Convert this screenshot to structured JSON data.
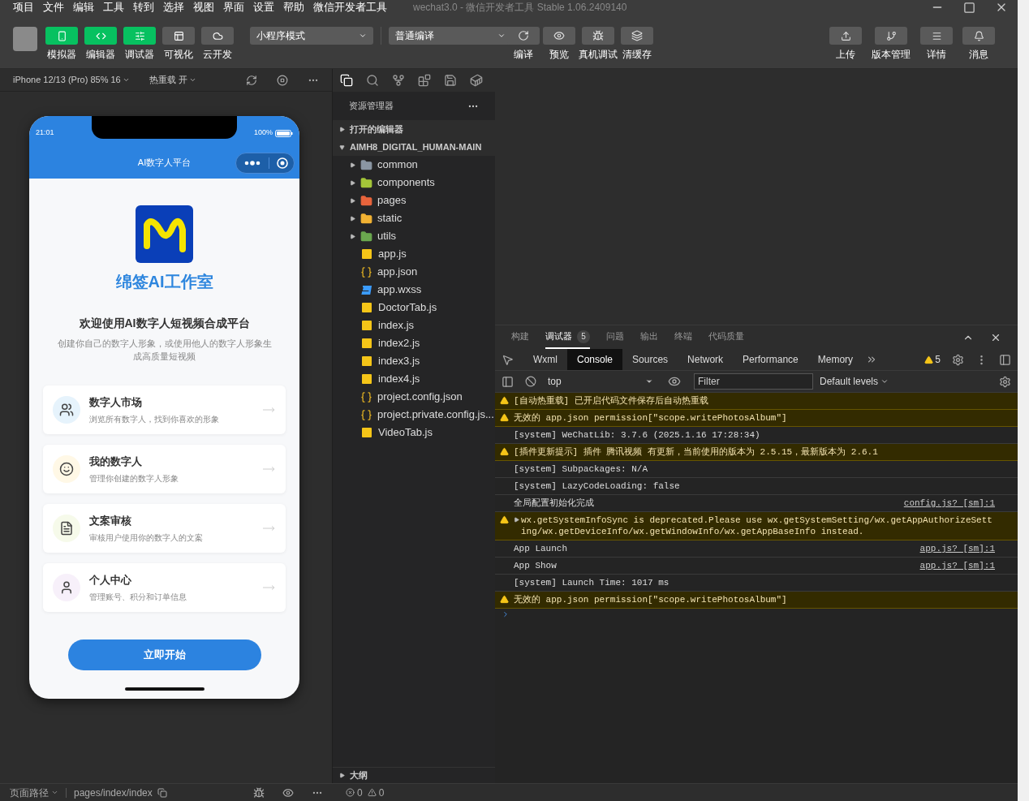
{
  "menu": [
    "项目",
    "文件",
    "编辑",
    "工具",
    "转到",
    "选择",
    "视图",
    "界面",
    "设置",
    "帮助",
    "微信开发者工具"
  ],
  "window_title": "wechat3.0 - 微信开发者工具 Stable 1.06.2409140",
  "toolbar": {
    "mode_buttons": [
      {
        "label": "模拟器",
        "selected": true
      },
      {
        "label": "编辑器",
        "selected": true
      },
      {
        "label": "调试器",
        "selected": true
      },
      {
        "label": "可视化",
        "selected": false
      },
      {
        "label": "云开发",
        "selected": false
      }
    ],
    "mode_select": "小程序模式",
    "compile_select": "普通编译",
    "actions": [
      "编译",
      "预览",
      "真机调试",
      "清缓存"
    ],
    "right_actions": [
      "上传",
      "版本管理",
      "详情",
      "消息"
    ]
  },
  "simulator": {
    "device": "iPhone 12/13 (Pro) 85% 16",
    "hot_reload": "热重载 开",
    "phone": {
      "time": "21:01",
      "battery": "100%",
      "nav_title": "AI数字人平台",
      "brand": "绵签AI工作室",
      "heading": "欢迎使用AI数字人短视频合成平台",
      "subtitle": "创建你自己的数字人形象，或使用他人的数字人形象生成高质量短视频",
      "cards": [
        {
          "title": "数字人市场",
          "description": "浏览所有数字人，找到你喜欢的形象",
          "color": "#e6f3fc"
        },
        {
          "title": "我的数字人",
          "description": "管理你创建的数字人形象",
          "color": "#fff8e6"
        },
        {
          "title": "文案审核",
          "description": "审核用户使用你的数字人的文案",
          "color": "#f6faea"
        },
        {
          "title": "个人中心",
          "description": "管理账号、积分和订单信息",
          "color": "#f7f0fa"
        }
      ],
      "start_button": "立即开始"
    }
  },
  "explorer": {
    "title": "资源管理器",
    "open_editors": {
      "label": "打开的编辑器",
      "expanded": false
    },
    "project": {
      "label": "AIMH8_DIGITAL_HUMAN-MAIN",
      "expanded": true,
      "children": [
        {
          "name": "common",
          "kind": "folder",
          "expanded": false,
          "color": "#8a96a3"
        },
        {
          "name": "components",
          "kind": "folder",
          "expanded": false,
          "color": "#a4c639"
        },
        {
          "name": "pages",
          "kind": "folder",
          "expanded": false,
          "color": "#e8643c"
        },
        {
          "name": "static",
          "kind": "folder",
          "expanded": false,
          "color": "#f2b233"
        },
        {
          "name": "utils",
          "kind": "folder",
          "expanded": false,
          "color": "#6aa84f"
        },
        {
          "name": "app.js",
          "kind": "js"
        },
        {
          "name": "app.json",
          "kind": "json"
        },
        {
          "name": "app.wxss",
          "kind": "wxss"
        },
        {
          "name": "DoctorTab.js",
          "kind": "js"
        },
        {
          "name": "index.js",
          "kind": "js"
        },
        {
          "name": "index2.js",
          "kind": "js"
        },
        {
          "name": "index3.js",
          "kind": "js"
        },
        {
          "name": "index4.js",
          "kind": "js"
        },
        {
          "name": "project.config.json",
          "kind": "json"
        },
        {
          "name": "project.private.config.js...",
          "kind": "json"
        },
        {
          "name": "VideoTab.js",
          "kind": "js"
        }
      ]
    },
    "outline": {
      "label": "大纲",
      "expanded": false
    }
  },
  "debugger": {
    "panel_tabs": [
      {
        "label": "构建",
        "selected": false
      },
      {
        "label": "调试器",
        "selected": true,
        "badge": "5"
      },
      {
        "label": "问题",
        "selected": false
      },
      {
        "label": "输出",
        "selected": false
      },
      {
        "label": "终端",
        "selected": false
      },
      {
        "label": "代码质量",
        "selected": false
      }
    ],
    "devtools_tabs": [
      {
        "label": "Wxml",
        "selected": false
      },
      {
        "label": "Console",
        "selected": true
      },
      {
        "label": "Sources",
        "selected": false
      },
      {
        "label": "Network",
        "selected": false
      },
      {
        "label": "Performance",
        "selected": false
      },
      {
        "label": "Memory",
        "selected": false
      }
    ],
    "warning_count": "5",
    "context": "top",
    "filter_placeholder": "Filter",
    "levels": "Default levels",
    "logs": [
      {
        "kind": "warning",
        "text": "[自动热重载] 已开启代码文件保存后自动热重载"
      },
      {
        "kind": "warning",
        "text": "无效的 app.json permission[\"scope.writePhotosAlbum\"]"
      },
      {
        "kind": "info",
        "text": "[system] WeChatLib: 3.7.6 (2025.1.16 17:28:34)"
      },
      {
        "kind": "warning",
        "text": "[插件更新提示] 插件 腾讯视频 有更新，当前使用的版本为 2.5.15，最新版本为 2.6.1"
      },
      {
        "kind": "info",
        "text": "[system] Subpackages: N/A"
      },
      {
        "kind": "info",
        "text": "[system] LazyCodeLoading: false"
      },
      {
        "kind": "info",
        "text": "全局配置初始化完成",
        "source": "config.js? [sm]:1"
      },
      {
        "kind": "warning",
        "expandable": true,
        "text": "wx.getSystemInfoSync is deprecated.Please use wx.getSystemSetting/wx.getAppAuthorizeSetting/wx.getDeviceInfo/wx.getWindowInfo/wx.getAppBaseInfo instead."
      },
      {
        "kind": "info",
        "text": "App Launch",
        "source": "app.js? [sm]:1"
      },
      {
        "kind": "info",
        "text": "App Show",
        "source": "app.js? [sm]:1"
      },
      {
        "kind": "info",
        "text": "[system] Launch Time: 1017 ms"
      },
      {
        "kind": "warning",
        "text": "无效的 app.json permission[\"scope.writePhotosAlbum\"]"
      }
    ]
  },
  "status_bar": {
    "page_path_label": "页面路径",
    "page_path": "pages/index/index",
    "errors": "0",
    "warnings": "0"
  }
}
